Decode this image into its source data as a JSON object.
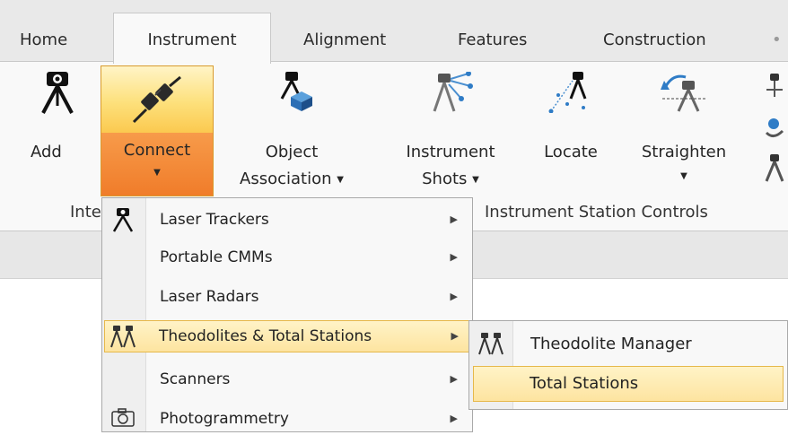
{
  "tabs": [
    {
      "label": "Home",
      "active": false
    },
    {
      "label": "Instrument",
      "active": true
    },
    {
      "label": "Alignment",
      "active": false
    },
    {
      "label": "Features",
      "active": false
    },
    {
      "label": "Construction",
      "active": false
    }
  ],
  "ribbon": {
    "add": {
      "label": "Add",
      "icon": "tripod-icon"
    },
    "connect": {
      "label": "Connect",
      "icon": "plug-icon"
    },
    "object_association": {
      "line1": "Object",
      "line2": "Association",
      "icon": "object-association-icon"
    },
    "instrument_shots": {
      "line1": "Instrument",
      "line2": "Shots",
      "icon": "instrument-shots-icon"
    },
    "locate": {
      "label": "Locate",
      "icon": "locate-icon"
    },
    "straighten": {
      "label": "Straighten",
      "icon": "straighten-icon"
    },
    "group_left_label": "Inte",
    "group_right_label": "Instrument Station Controls"
  },
  "connect_menu": {
    "items": [
      {
        "label": "Laser Trackers",
        "icon": "tripod-icon",
        "has_submenu": true
      },
      {
        "label": "Portable CMMs",
        "has_submenu": true
      },
      {
        "label": "Laser Radars",
        "has_submenu": true
      },
      {
        "label": "Theodolites & Total Stations",
        "icon": "theodolite-icon",
        "has_submenu": true,
        "highlighted": true
      },
      {
        "label": "Scanners",
        "has_submenu": true
      },
      {
        "label": "Photogrammetry",
        "icon": "camera-icon",
        "has_submenu": true
      }
    ]
  },
  "submenu": {
    "items": [
      {
        "label": "Theodolite Manager",
        "icon": "theodolite-icon"
      },
      {
        "label": "Total Stations",
        "highlighted": true
      }
    ]
  },
  "colors": {
    "accent_orange": "#f07c2a",
    "highlight_yellow": "#fde4a0",
    "highlight_border": "#e6b84a",
    "ribbon_bg": "#f9f9f9",
    "tabbar_bg": "#e9e9e9"
  }
}
